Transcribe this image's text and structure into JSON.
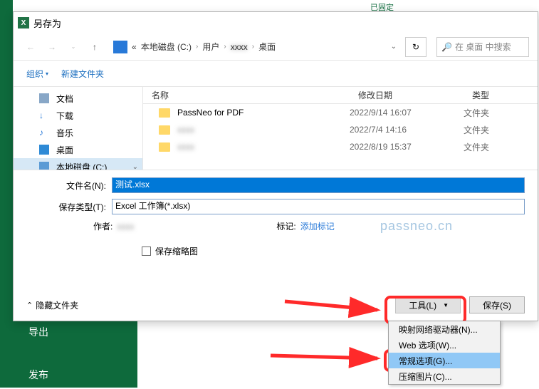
{
  "excel": {
    "top_text": "已固定",
    "menu_export": "导出",
    "menu_publish": "发布"
  },
  "dialog": {
    "title": "另存为"
  },
  "nav": {
    "crumb1": "«",
    "crumb2": "本地磁盘 (C:)",
    "crumb3": "用户",
    "crumb4_blur": "xxxx",
    "crumb5": "桌面",
    "search_placeholder": "在 桌面 中搜索"
  },
  "toolbar": {
    "organize": "组织",
    "newfolder": "新建文件夹"
  },
  "sidebar": {
    "items": [
      {
        "label": "文档",
        "color": "#6a8caf"
      },
      {
        "label": "下载",
        "color": "#3a7abd"
      },
      {
        "label": "音乐",
        "color": "#2879d8"
      },
      {
        "label": "桌面",
        "color": "#2e8ad6"
      },
      {
        "label": "本地磁盘 (C:)",
        "color": "#5b9bd5"
      }
    ]
  },
  "list": {
    "col_name": "名称",
    "col_date": "修改日期",
    "col_type": "类型",
    "rows": [
      {
        "name": "PassNeo for PDF",
        "date": "2022/9/14 16:07",
        "type": "文件夹",
        "blur": false
      },
      {
        "name": "xxxx",
        "date": "2022/7/4 14:16",
        "type": "文件夹",
        "blur": true
      },
      {
        "name": "xxxx",
        "date": "2022/8/19 15:37",
        "type": "文件夹",
        "blur": true
      }
    ]
  },
  "form": {
    "filename_label": "文件名(N):",
    "filename_value": "测试.xlsx",
    "filetype_label": "保存类型(T):",
    "filetype_value": "Excel 工作簿(*.xlsx)",
    "author_label": "作者:",
    "author_value": "xxxx",
    "tags_label": "标记:",
    "tags_value": "添加标记",
    "thumb_label": "保存缩略图"
  },
  "footer": {
    "hide_folders": "隐藏文件夹",
    "tools_label": "工具(L)",
    "save_label": "保存(S)"
  },
  "dropdown": {
    "items": [
      {
        "label": "映射网络驱动器(N)...",
        "hl": false
      },
      {
        "label": "Web 选项(W)...",
        "hl": false
      },
      {
        "label": "常规选项(G)...",
        "hl": true
      },
      {
        "label": "压缩图片(C)...",
        "hl": false
      }
    ]
  },
  "watermark": "passneo.cn"
}
